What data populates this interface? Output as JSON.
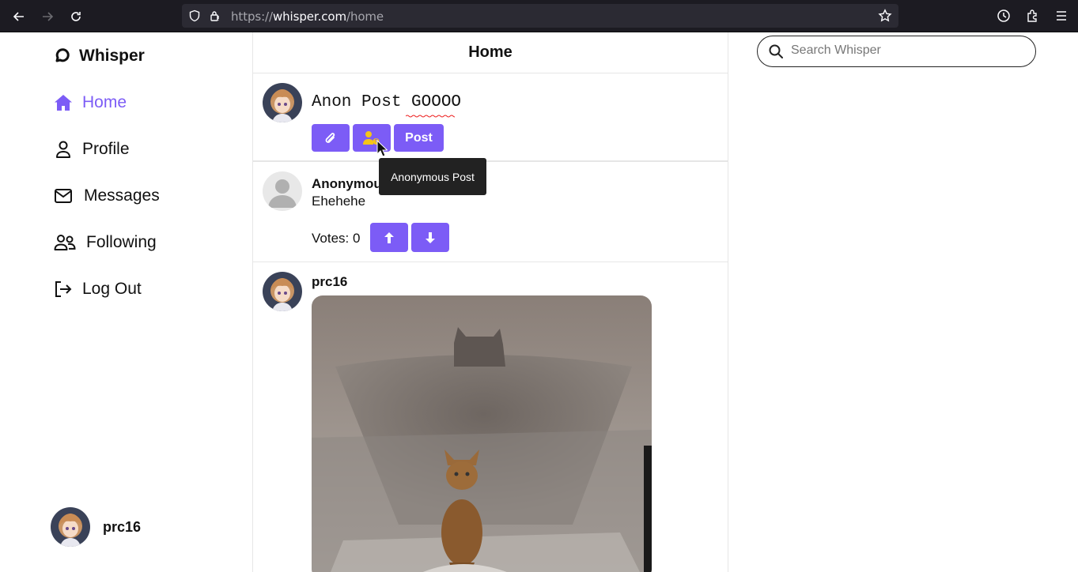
{
  "browser": {
    "url_scheme": "https://",
    "url_host": "whisper.com",
    "url_path": "/home"
  },
  "sidebar": {
    "brand": "Whisper",
    "items": [
      {
        "label": "Home",
        "icon": "home-icon",
        "active": true
      },
      {
        "label": "Profile",
        "icon": "user-icon",
        "active": false
      },
      {
        "label": "Messages",
        "icon": "envelope-icon",
        "active": false
      },
      {
        "label": "Following",
        "icon": "users-icon",
        "active": false
      },
      {
        "label": "Log Out",
        "icon": "logout-icon",
        "active": false
      }
    ],
    "username": "prc16"
  },
  "feed": {
    "title": "Home",
    "composer": {
      "value": "Anon Post GOOOO",
      "post_label": "Post",
      "attach_icon": "paperclip-icon",
      "anon_icon": "anonymous-user-icon",
      "tooltip": "Anonymous Post"
    },
    "posts": [
      {
        "author": "Anonymous",
        "text": "Ehehehe",
        "votes_label": "Votes: 0"
      },
      {
        "author": "prc16",
        "image": "cat-photo"
      }
    ]
  },
  "search": {
    "placeholder": "Search Whisper"
  },
  "colors": {
    "accent": "#7c5cf6",
    "anon_icon": "#f5c518"
  }
}
